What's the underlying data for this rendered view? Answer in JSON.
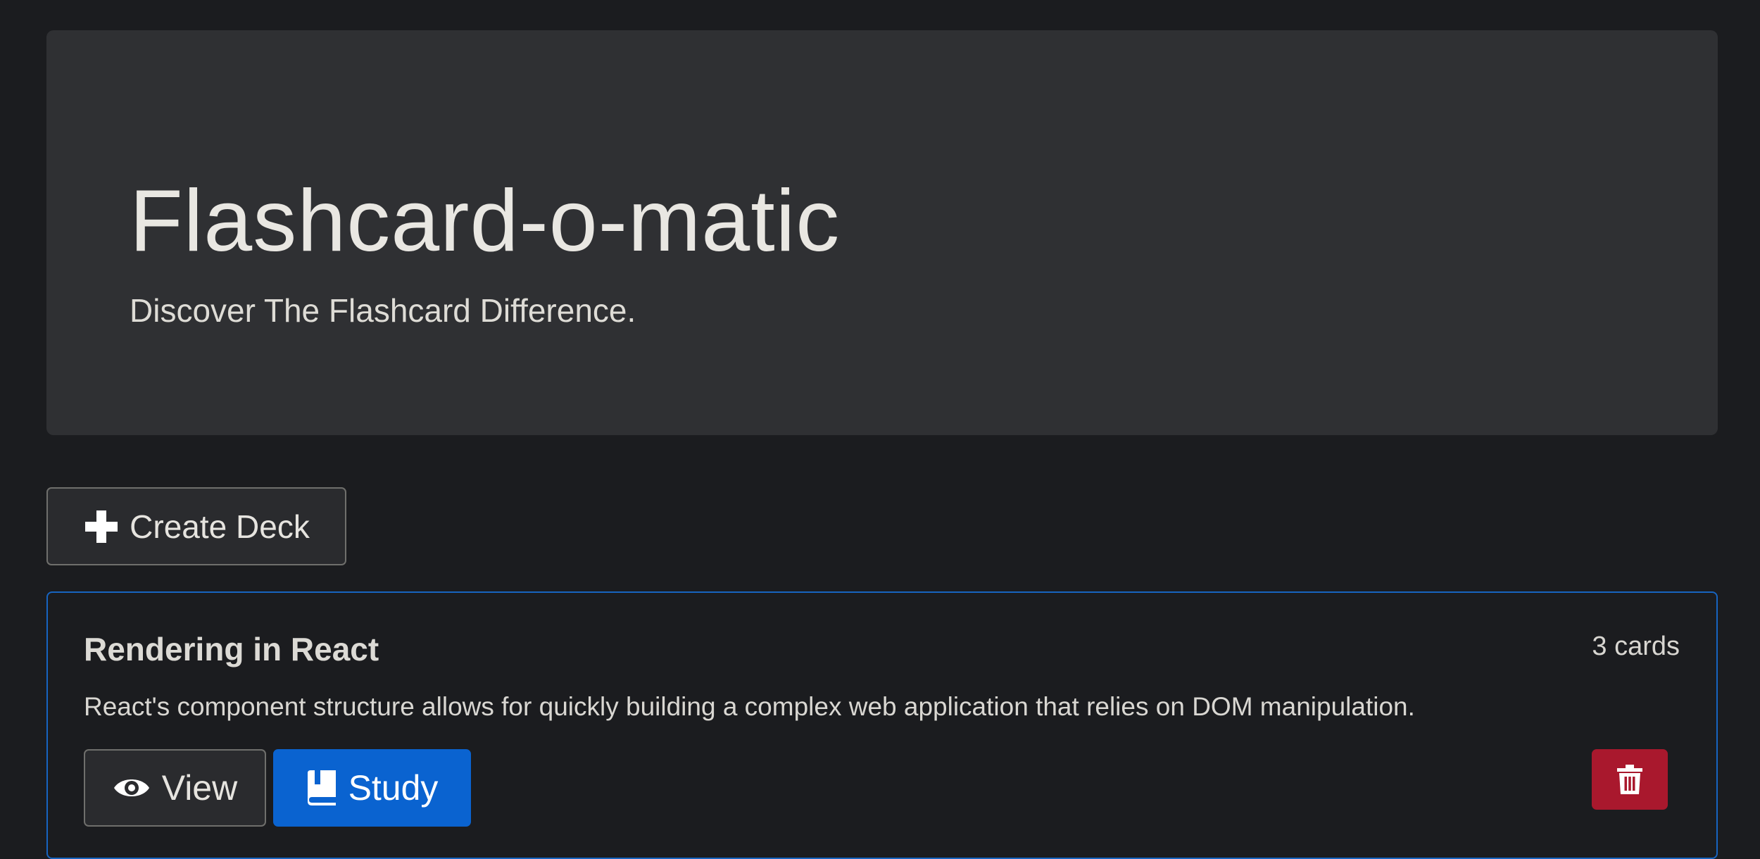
{
  "hero": {
    "title": "Flashcard-o-matic",
    "subtitle": "Discover The Flashcard Difference."
  },
  "toolbar": {
    "create_label": "Create Deck",
    "create_icon": "plus-icon"
  },
  "decks": [
    {
      "name": "Rendering in React",
      "count": "3 cards",
      "description": "React's component structure allows for quickly building a complex web application that relies on DOM manipulation.",
      "view_label": "View",
      "view_icon": "eye-icon",
      "study_label": "Study",
      "study_icon": "book-icon",
      "delete_icon": "trash-icon"
    }
  ],
  "colors": {
    "background": "#1b1c1f",
    "hero_background": "#2f3033",
    "primary": "#0a63d0",
    "danger": "#a9182d",
    "card_border": "#1764c0"
  }
}
